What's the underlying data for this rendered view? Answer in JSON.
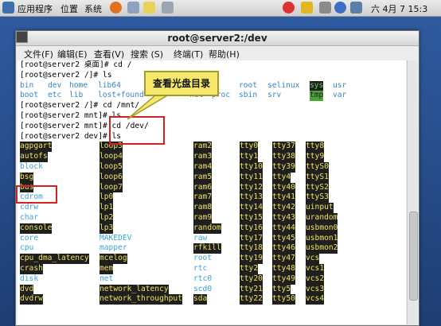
{
  "panel": {
    "applications": "应用程序",
    "places": "位置",
    "system": "系统",
    "clock": "六 4月  7 15:3"
  },
  "window": {
    "title": "root@server2:/dev",
    "menu": [
      "文件(F)",
      "编辑(E)",
      "查看(V)",
      "搜索 (S)",
      "终端(T)",
      "帮助(H)"
    ]
  },
  "callout": "查看光盘目录",
  "terminal": {
    "lines": [
      "[root@server2 桌面]# cd /",
      "[root@server2 /]# ls",
      "",
      "",
      "[root@server2 /]# cd /mnt/",
      "[root@server2 mnt]# ls",
      "[root@server2 mnt]# cd /dev/",
      "[root@server2 dev]# ls"
    ],
    "root_ls_row1": [
      "bin",
      "dev",
      "home",
      "lib64",
      "root",
      "selinux",
      "sys",
      "usr"
    ],
    "root_ls_row2": [
      "boot",
      "etc",
      "lib",
      "lost+found",
      "net",
      "proc",
      "sbin",
      "srv",
      "tmp",
      "var"
    ],
    "dev_col1": [
      "agpgart",
      "autofs",
      "block",
      "bsg",
      "bus",
      "cdrom",
      "cdrw",
      "char",
      "console",
      "core",
      "cpu",
      "cpu_dma_latency",
      "crash",
      "disk",
      "dvd",
      "dvdrw"
    ],
    "dev_col2": [
      "loop3",
      "loop4",
      "loop5",
      "loop6",
      "loop7",
      "lp0",
      "lp1",
      "lp2",
      "lp3",
      "MAKEDEV",
      "mapper",
      "mcelog",
      "mem",
      "net",
      "network_latency",
      "network_throughput"
    ],
    "dev_col3": [
      "ram2",
      "ram3",
      "ram4",
      "ram5",
      "ram6",
      "ram7",
      "ram8",
      "ram9",
      "random",
      "raw",
      "rfkill",
      "root",
      "rtc",
      "rtc0",
      "scd0",
      "sda"
    ],
    "dev_col4": [
      "tty0",
      "tty1",
      "tty10",
      "tty11",
      "tty12",
      "tty13",
      "tty14",
      "tty15",
      "tty16",
      "tty17",
      "tty18",
      "tty19",
      "tty2",
      "tty20",
      "tty21",
      "tty22"
    ],
    "dev_col5": [
      "tty37",
      "tty38",
      "tty39",
      "tty4",
      "tty40",
      "tty41",
      "tty42",
      "tty43",
      "tty44",
      "tty45",
      "tty46",
      "tty47",
      "tty48",
      "tty49",
      "tty5",
      "tty50"
    ],
    "dev_col6": [
      "tty8",
      "tty9",
      "ttyS0",
      "ttyS1",
      "ttyS2",
      "ttyS3",
      "uinput",
      "urandom",
      "usbmon0",
      "usbmon1",
      "usbmon2",
      "vcs",
      "vcs1",
      "vcs2",
      "vcs3",
      "vcs4"
    ]
  }
}
